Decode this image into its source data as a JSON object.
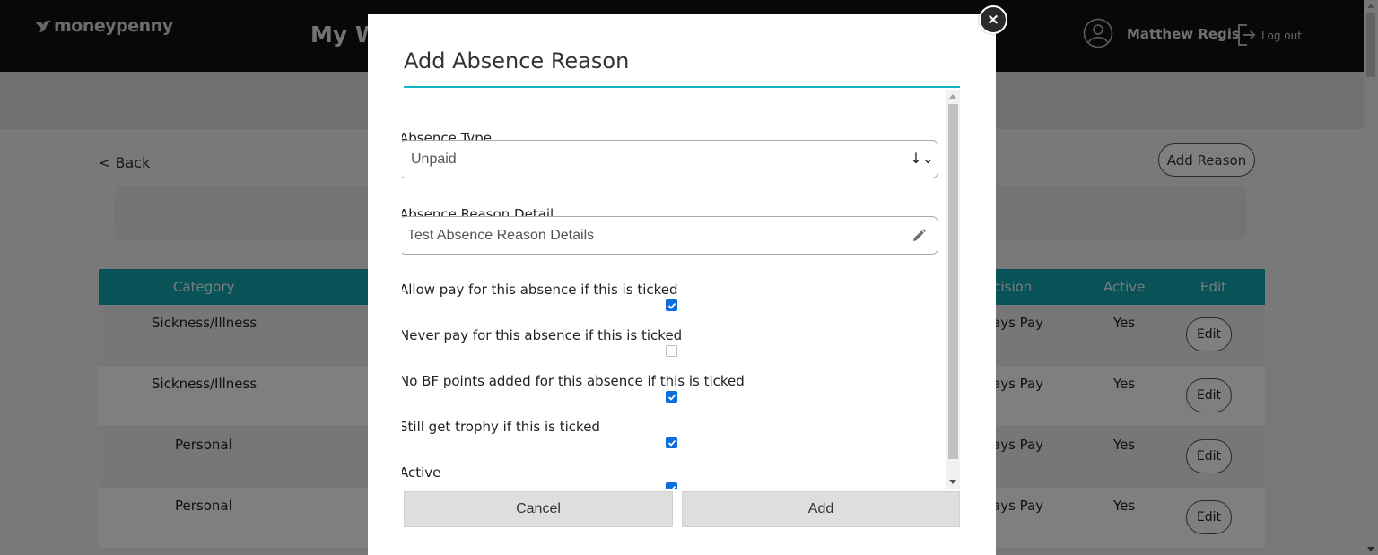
{
  "header": {
    "brand": "moneypenny",
    "app_title": "My W",
    "user_name": "Matthew Regis",
    "logout_label": "Log out"
  },
  "page": {
    "back_label": "< Back",
    "add_reason_label": "Add Reason"
  },
  "table": {
    "columns": [
      "Category",
      "ecision",
      "Active",
      "Edit"
    ],
    "rows": [
      {
        "category": "Sickness/Illness",
        "decision": "ays Pay",
        "active": "Yes",
        "edit": "Edit"
      },
      {
        "category": "Sickness/Illness",
        "decision": "ays Pay",
        "active": "Yes",
        "edit": "Edit"
      },
      {
        "category": "Personal",
        "decision": "ays Pay",
        "active": "Yes",
        "edit": "Edit"
      },
      {
        "category": "Personal",
        "decision": "ays Pay",
        "active": "Yes",
        "edit": "Edit"
      }
    ]
  },
  "modal": {
    "title": "Add Absence Reason",
    "close_glyph": "×",
    "absence_type_label": "Absence Type",
    "absence_type_value": "Unpaid",
    "absence_detail_label": "Absence Reason Detail",
    "absence_detail_value": "Test Absence Reason Details",
    "checkboxes": [
      {
        "label": "Allow pay for this absence if this is ticked",
        "checked": true
      },
      {
        "label": "Never pay for this absence if this is ticked",
        "checked": false
      },
      {
        "label": "No BF points added for this absence if this is ticked",
        "checked": true
      },
      {
        "label": "Still get trophy if this is ticked",
        "checked": true
      },
      {
        "label": "Active",
        "checked": true
      }
    ],
    "cancel_label": "Cancel",
    "add_label": "Add"
  },
  "colors": {
    "accent": "#11b5c0",
    "table_header": "#11a5b1",
    "checkbox": "#0b6ddc"
  }
}
